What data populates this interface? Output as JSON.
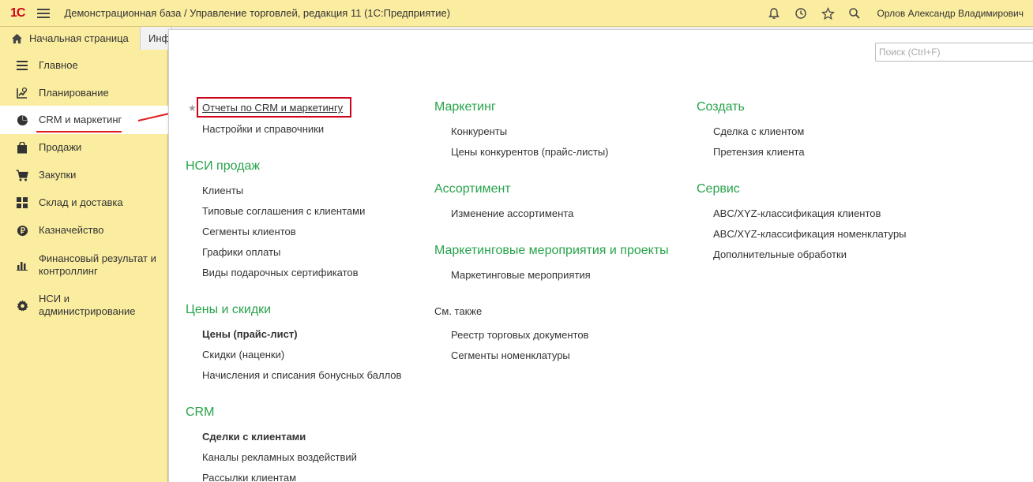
{
  "app": {
    "logo": "1С",
    "title": "Демонстрационная база / Управление торговлей, редакция 11  (1С:Предприятие)",
    "user": "Орлов Александр Владимирович",
    "colors": {
      "accent_bar": "#fbeda0",
      "group_heading": "#27a34a",
      "highlight": "#d0021b"
    }
  },
  "tabs": [
    {
      "label": "Начальная страница",
      "icon": "home-icon"
    },
    {
      "label": "Инф"
    }
  ],
  "sidebar": {
    "items": [
      {
        "label": "Главное",
        "icon": "list-icon"
      },
      {
        "label": "Планирование",
        "icon": "planning-icon"
      },
      {
        "label": "CRM и маркетинг",
        "icon": "pie-chart-icon",
        "active": true
      },
      {
        "label": "Продажи",
        "icon": "shopping-bag-icon"
      },
      {
        "label": "Закупки",
        "icon": "cart-icon"
      },
      {
        "label": "Склад и доставка",
        "icon": "grid-icon"
      },
      {
        "label": "Казначейство",
        "icon": "ruble-coin-icon"
      },
      {
        "label": "Финансовый результат и контроллинг",
        "icon": "bar-chart-icon"
      },
      {
        "label": "НСИ и администрирование",
        "icon": "gear-icon"
      }
    ]
  },
  "search": {
    "placeholder": "Поиск (Ctrl+F)"
  },
  "columns": {
    "col1": {
      "top_links": [
        "Отчеты по CRM и маркетингу",
        "Настройки и справочники"
      ],
      "groups": [
        {
          "title": "НСИ продаж",
          "links": [
            "Клиенты",
            "Типовые соглашения с клиентами",
            "Сегменты клиентов",
            "Графики оплаты",
            "Виды подарочных сертификатов"
          ]
        },
        {
          "title": "Цены и скидки",
          "links": [
            "Цены (прайс-лист)",
            "Скидки (наценки)",
            "Начисления и списания бонусных баллов"
          ]
        },
        {
          "title": "CRM",
          "links": [
            "Сделки с клиентами",
            "Каналы рекламных воздействий",
            "Рассылки клиентам"
          ]
        }
      ]
    },
    "col2": {
      "groups": [
        {
          "title": "Маркетинг",
          "links": [
            "Конкуренты",
            "Цены конкурентов (прайс-листы)"
          ]
        },
        {
          "title": "Ассортимент",
          "links": [
            "Изменение ассортимента"
          ]
        },
        {
          "title": "Маркетинговые мероприятия и проекты",
          "links": [
            "Маркетинговые мероприятия"
          ]
        }
      ],
      "see_also": {
        "title": "См. также",
        "links": [
          "Реестр торговых документов",
          "Сегменты номенклатуры"
        ]
      }
    },
    "col3": {
      "groups": [
        {
          "title": "Создать",
          "links": [
            "Сделка с клиентом",
            "Претензия клиента"
          ]
        },
        {
          "title": "Сервис",
          "links": [
            "ABC/XYZ-классификация клиентов",
            "ABC/XYZ-классификация номенклатуры",
            "Дополнительные обработки"
          ]
        }
      ]
    }
  }
}
